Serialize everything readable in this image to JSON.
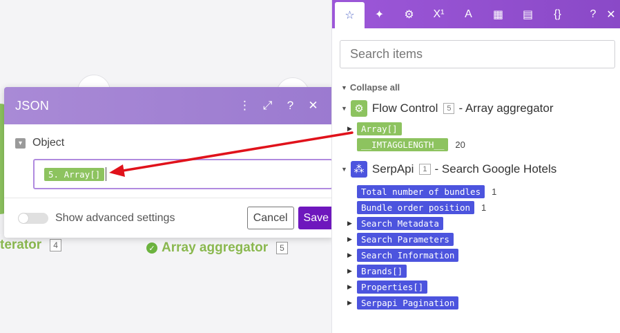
{
  "canvas": {
    "left_module_label": "terator",
    "left_module_num": "4",
    "aggregator_label": "Array aggregator",
    "aggregator_num": "5"
  },
  "dialog": {
    "title": "JSON",
    "object_label": "Object",
    "field_pill": "5. Array[]",
    "advanced_label": "Show advanced settings",
    "cancel_label": "Cancel",
    "save_label": "Save"
  },
  "panel": {
    "tabs": [
      {
        "icon": "star-icon",
        "glyph": "☆"
      },
      {
        "icon": "sparkle-icon",
        "glyph": "✦"
      },
      {
        "icon": "gear-icon",
        "glyph": "⚙"
      },
      {
        "icon": "superscript-icon",
        "glyph": "X¹"
      },
      {
        "icon": "text-icon",
        "glyph": "A"
      },
      {
        "icon": "calendar-icon",
        "glyph": "▦"
      },
      {
        "icon": "table-icon",
        "glyph": "▤"
      },
      {
        "icon": "braces-icon",
        "glyph": "{}"
      }
    ],
    "help_glyph": "?",
    "close_glyph": "✕",
    "search_placeholder": "Search items",
    "collapse_label": "Collapse all",
    "flow": {
      "title": "Flow Control",
      "num": "5",
      "subtitle": "- Array aggregator",
      "items": [
        {
          "label": "Array[]",
          "value": ""
        },
        {
          "label": "__IMTAGGLENGTH__",
          "value": "20"
        }
      ]
    },
    "serp": {
      "title": "SerpApi",
      "num": "1",
      "subtitle": "- Search Google Hotels",
      "items": [
        {
          "label": "Total number of bundles",
          "value": "1"
        },
        {
          "label": "Bundle order position",
          "value": "1"
        },
        {
          "label": "Search Metadata",
          "value": ""
        },
        {
          "label": "Search Parameters",
          "value": ""
        },
        {
          "label": "Search Information",
          "value": ""
        },
        {
          "label": "Brands[]",
          "value": ""
        },
        {
          "label": "Properties[]",
          "value": ""
        },
        {
          "label": "Serpapi Pagination",
          "value": ""
        }
      ]
    }
  },
  "colors": {
    "panel_header": "#9c57d8",
    "dialog_header": "#a98ad6",
    "green_pill": "#8dc35f",
    "blue_pill": "#4c54de",
    "save_button": "#6e17bd",
    "arrow": "#e0121b"
  }
}
